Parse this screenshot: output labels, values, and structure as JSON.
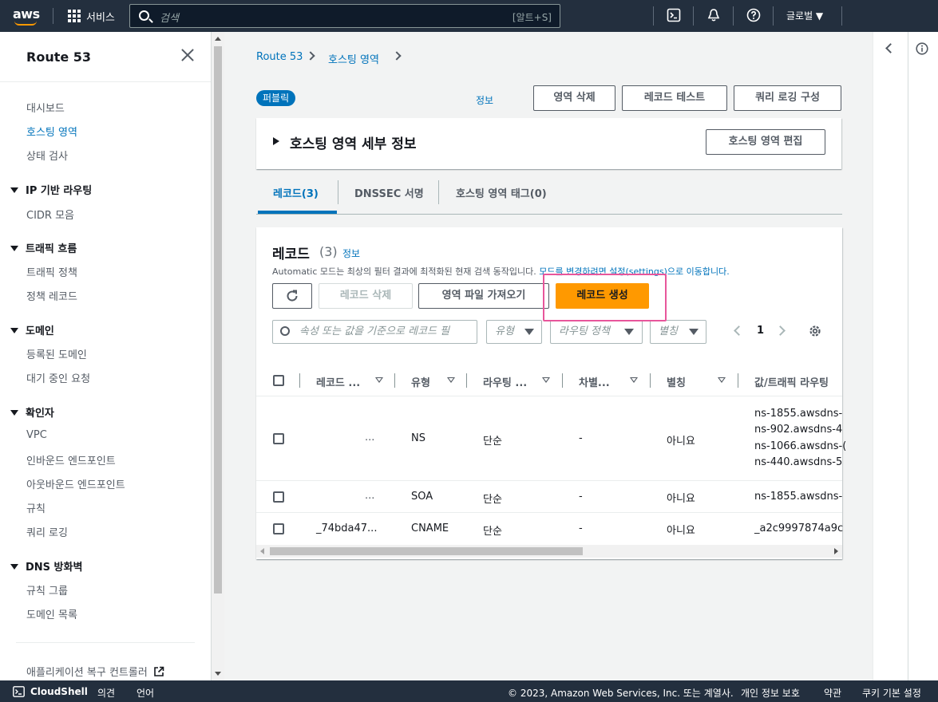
{
  "topbar": {
    "logo": "aws",
    "services": "서비스",
    "search_placeholder": "검색",
    "search_shortcut": "[알트+S]",
    "region": "글로벌 ▼"
  },
  "sidebar": {
    "title": "Route 53",
    "items": [
      {
        "label": "대시보드"
      },
      {
        "label": "호스팅 영역"
      },
      {
        "label": "상태 검사"
      },
      {
        "label": "IP 기반 라우팅"
      },
      {
        "label": "CIDR 모음"
      },
      {
        "label": "트래픽 흐름"
      },
      {
        "label": "트래픽 정책"
      },
      {
        "label": "정책 레코드"
      },
      {
        "label": "도메인"
      },
      {
        "label": "등록된 도메인"
      },
      {
        "label": "대기 중인 요청"
      },
      {
        "label": "확인자"
      },
      {
        "label": "VPC"
      },
      {
        "label": "인바운드 엔드포인트"
      },
      {
        "label": "아웃바운드 엔드포인트"
      },
      {
        "label": "규칙"
      },
      {
        "label": "쿼리 로깅"
      },
      {
        "label": "DNS 방화벽"
      },
      {
        "label": "규칙 그룹"
      },
      {
        "label": "도메인 목록"
      },
      {
        "label": "애플리케이션 복구 컨트롤러"
      }
    ]
  },
  "breadcrumb": {
    "root": "Route 53",
    "current": "호스팅 영역"
  },
  "header": {
    "badge": "퍼블릭",
    "info": "정보",
    "delete_zone": "영역 삭제",
    "test_record": "레코드 테스트",
    "query_logging": "쿼리 로깅 구성"
  },
  "details": {
    "title": "호스팅 영역 세부 정보",
    "edit": "호스팅 영역 편집"
  },
  "tabs": [
    {
      "label": "레코드(3)"
    },
    {
      "label": "DNSSEC 서명"
    },
    {
      "label": "호스팅 영역 태그(0)"
    }
  ],
  "records": {
    "title": "레코드",
    "count": "(3)",
    "info": "정보",
    "desc_text": "Automatic 모드는 최상의 필터 결과에 최적화된 현재 검색 동작입니다. ",
    "desc_link": "모드를 변경하려면 설정(settings)으로 이동합니다.",
    "delete_btn": "레코드 삭제",
    "import_btn": "영역 파일 가져오기",
    "create_btn": "레코드 생성",
    "filter_placeholder": "속성 또는 값을 기준으로 레코드 필",
    "type_filter": "유형",
    "routing_filter": "라우팅 정책",
    "alias_filter": "별칭",
    "page": "1",
    "columns": [
      "레코드 ...",
      "유형",
      "라우팅 ...",
      "차별...",
      "별칭",
      "값/트래픽 라우팅"
    ],
    "rows": [
      {
        "name": "...",
        "type": "NS",
        "routing": "단순",
        "diff": "-",
        "alias": "아니요",
        "values": [
          "ns-1855.awsdns-",
          "ns-902.awsdns-4",
          "ns-1066.awsdns-(",
          "ns-440.awsdns-5"
        ]
      },
      {
        "name": "...",
        "type": "SOA",
        "routing": "단순",
        "diff": "-",
        "alias": "아니요",
        "values": [
          "ns-1855.awsdns-"
        ]
      },
      {
        "name": "_74bda47...",
        "type": "CNAME",
        "routing": "단순",
        "diff": "-",
        "alias": "아니요",
        "values": [
          "_a2c9997874a9c"
        ]
      }
    ]
  },
  "footer": {
    "cloudshell": "CloudShell",
    "feedback": "의견",
    "language": "언어",
    "copyright": "© 2023, Amazon Web Services, Inc. 또는 계열사.",
    "privacy": "개인 정보 보호",
    "terms": "약관",
    "cookies": "쿠키 기본 설정"
  }
}
